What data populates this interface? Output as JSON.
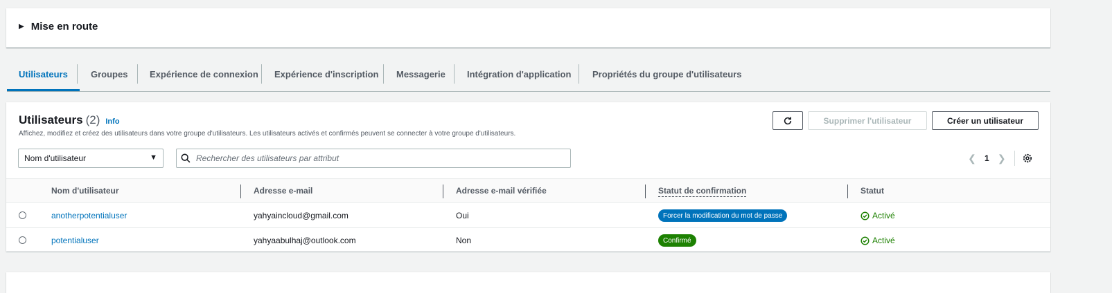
{
  "getting_started": {
    "title": "Mise en route"
  },
  "tabs": [
    {
      "label": "Utilisateurs",
      "active": true
    },
    {
      "label": "Groupes"
    },
    {
      "label": "Expérience de connexion"
    },
    {
      "label": "Expérience d'inscription"
    },
    {
      "label": "Messagerie"
    },
    {
      "label": "Intégration d'application"
    },
    {
      "label": "Propriétés du groupe d'utilisateurs"
    }
  ],
  "users_panel": {
    "title": "Utilisateurs",
    "count": "(2)",
    "info_label": "Info",
    "description": "Affichez, modifiez et créez des utilisateurs dans votre groupe d'utilisateurs. Les utilisateurs activés et confirmés peuvent se connecter à votre groupe d'utilisateurs.",
    "delete_button": "Supprimer l'utilisateur",
    "create_button": "Créer un utilisateur",
    "attribute_select": "Nom d'utilisateur",
    "search_placeholder": "Rechercher des utilisateurs par attribut",
    "page_number": "1"
  },
  "table": {
    "columns": [
      "Nom d'utilisateur",
      "Adresse e-mail",
      "Adresse e-mail vérifiée",
      "Statut de confirmation",
      "Statut"
    ],
    "rows": [
      {
        "username": "anotherpotentialuser",
        "email": "yahyaincloud@gmail.com",
        "verified": "Oui",
        "confirmation": "Forcer la modification du mot de passe",
        "confirmation_color": "#0073bb",
        "status": "Activé"
      },
      {
        "username": "potentialuser",
        "email": "yahyaabulhaj@outlook.com",
        "verified": "Non",
        "confirmation": "Confirmé",
        "confirmation_color": "#1d8102",
        "status": "Activé"
      }
    ]
  },
  "colors": {
    "accent": "#0073bb",
    "success": "#1d8102"
  }
}
